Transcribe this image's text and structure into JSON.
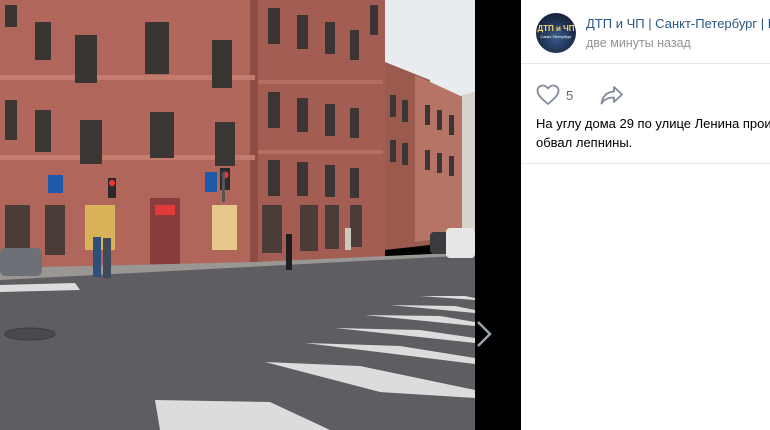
{
  "post": {
    "group_name": "ДТП и ЧП | Санкт-Петербург | Г",
    "time": "две минуты назад",
    "likes": "5",
    "text_line1": "На углу дома 29 по улице Ленина прои",
    "text_line2": "обвал лепнины."
  },
  "avatar": {
    "title": "ДТП и ЧП",
    "subtitle": "Санкт-Петербург"
  },
  "icons": {
    "like": "heart-icon",
    "share": "share-arrow-icon",
    "next": "chevron-right-icon"
  },
  "colors": {
    "link": "#2a5885",
    "muted": "#939393",
    "icon": "#828a99",
    "viewer_bg": "#000000"
  }
}
